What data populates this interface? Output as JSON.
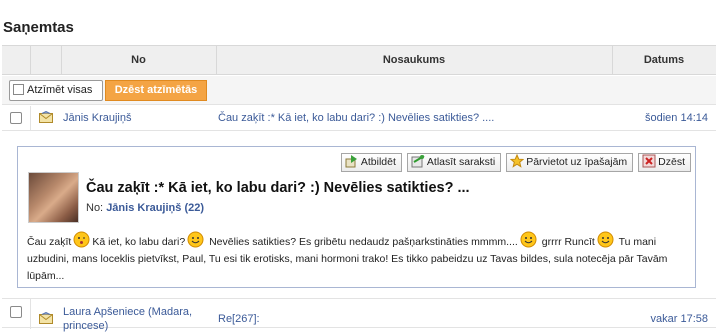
{
  "page": {
    "title": "Saņemtas"
  },
  "table": {
    "headers": {
      "no": "No",
      "name": "Nosaukums",
      "date": "Datums"
    }
  },
  "actions": {
    "select_all": "Atzīmēt visas",
    "delete_selected": "Dzēst atzīmētās"
  },
  "messages": [
    {
      "sender": "Jānis Kraujiņš",
      "subject": "Čau zaķīt :* Kā iet, ko labu dari? :) Nevēlies satikties? ....",
      "date": "šodien 14:14"
    },
    {
      "sender_line1": "Laura Apšeniece (Madara,",
      "sender_line2": "princese)",
      "subject": "Re[267]:",
      "date": "vakar 17:58"
    }
  ],
  "expanded": {
    "toolbar": {
      "reply": "Atbildēt",
      "add_list": "Atlasīt saraksti",
      "move": "Pārvietot uz īpašajām",
      "delete": "Dzēst"
    },
    "title": "Čau zaķīt :* Kā iet, ko labu dari? :) Nevēlies satikties? ...",
    "from_label": "No:",
    "from_name": "Jānis Kraujiņš (22)",
    "body": {
      "p1": "Čau zaķīt",
      "p2": "Kā iet, ko labu dari?",
      "p3": "Nevēlies satikties? Es gribētu nedaudz pašņarkstināties mmmm....",
      "p4": "grrrr Runcīt",
      "p5": "Tu mani uzbudini, mans loceklis pietvīkst, Paul, Tu esi tik erotisks, mani hormoni trako! Es tikko pabeidzu uz Tavas bildes, sula notecēja pār Tavām lūpām..."
    }
  },
  "colors": {
    "link": "#3b5a98",
    "accent": "#f4a444",
    "border": "#a9b6d3"
  }
}
